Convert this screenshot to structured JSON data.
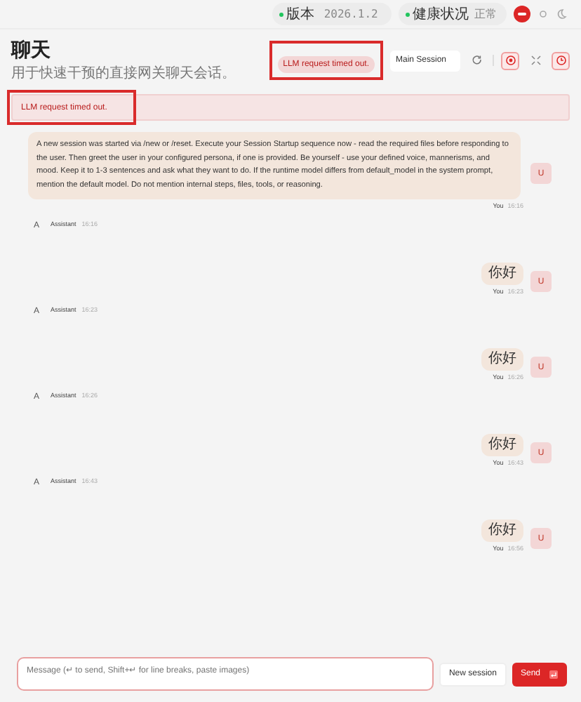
{
  "top_bar": {
    "badges": [
      {
        "label": "版本",
        "value": "2026.1.2"
      },
      {
        "label": "健康状况",
        "value": "正常"
      }
    ]
  },
  "header": {
    "title": "聊天",
    "subtitle": "用于快速干预的直接网关聊天会话。",
    "error_chip": "LLM request timed out.",
    "session_select": "Main Session"
  },
  "error_banner": "LLM request timed out.",
  "messages": [
    {
      "kind": "user",
      "text": "A new session was started via /new or /reset. Execute your Session Startup sequence now - read the required files before responding to the user. Then greet the user in your configured persona, if one is provided. Be yourself - use your defined voice, mannerisms, and mood. Keep it to 1-3 sentences and ask what they want to do. If the runtime model differs from default_model in the system prompt, mention the default model. Do not mention internal steps, files, tools, or reasoning.",
      "sender": "You",
      "time": "16:16",
      "avatar": "U"
    },
    {
      "kind": "assistant",
      "sender": "Assistant",
      "time": "16:16",
      "avatar": "A"
    },
    {
      "kind": "user",
      "text": "你好",
      "sender": "You",
      "time": "16:23",
      "avatar": "U"
    },
    {
      "kind": "assistant",
      "sender": "Assistant",
      "time": "16:23",
      "avatar": "A"
    },
    {
      "kind": "user",
      "text": "你好",
      "sender": "You",
      "time": "16:26",
      "avatar": "U"
    },
    {
      "kind": "assistant",
      "sender": "Assistant",
      "time": "16:26",
      "avatar": "A"
    },
    {
      "kind": "user",
      "text": "你好",
      "sender": "You",
      "time": "16:43",
      "avatar": "U"
    },
    {
      "kind": "assistant",
      "sender": "Assistant",
      "time": "16:43",
      "avatar": "A"
    },
    {
      "kind": "user",
      "text": "你好",
      "sender": "You",
      "time": "16:56",
      "avatar": "U"
    }
  ],
  "composer": {
    "placeholder": "Message (↵ to send, Shift+↵ for line breaks, paste images)"
  },
  "buttons": {
    "new_session": "New session",
    "send": "Send"
  }
}
